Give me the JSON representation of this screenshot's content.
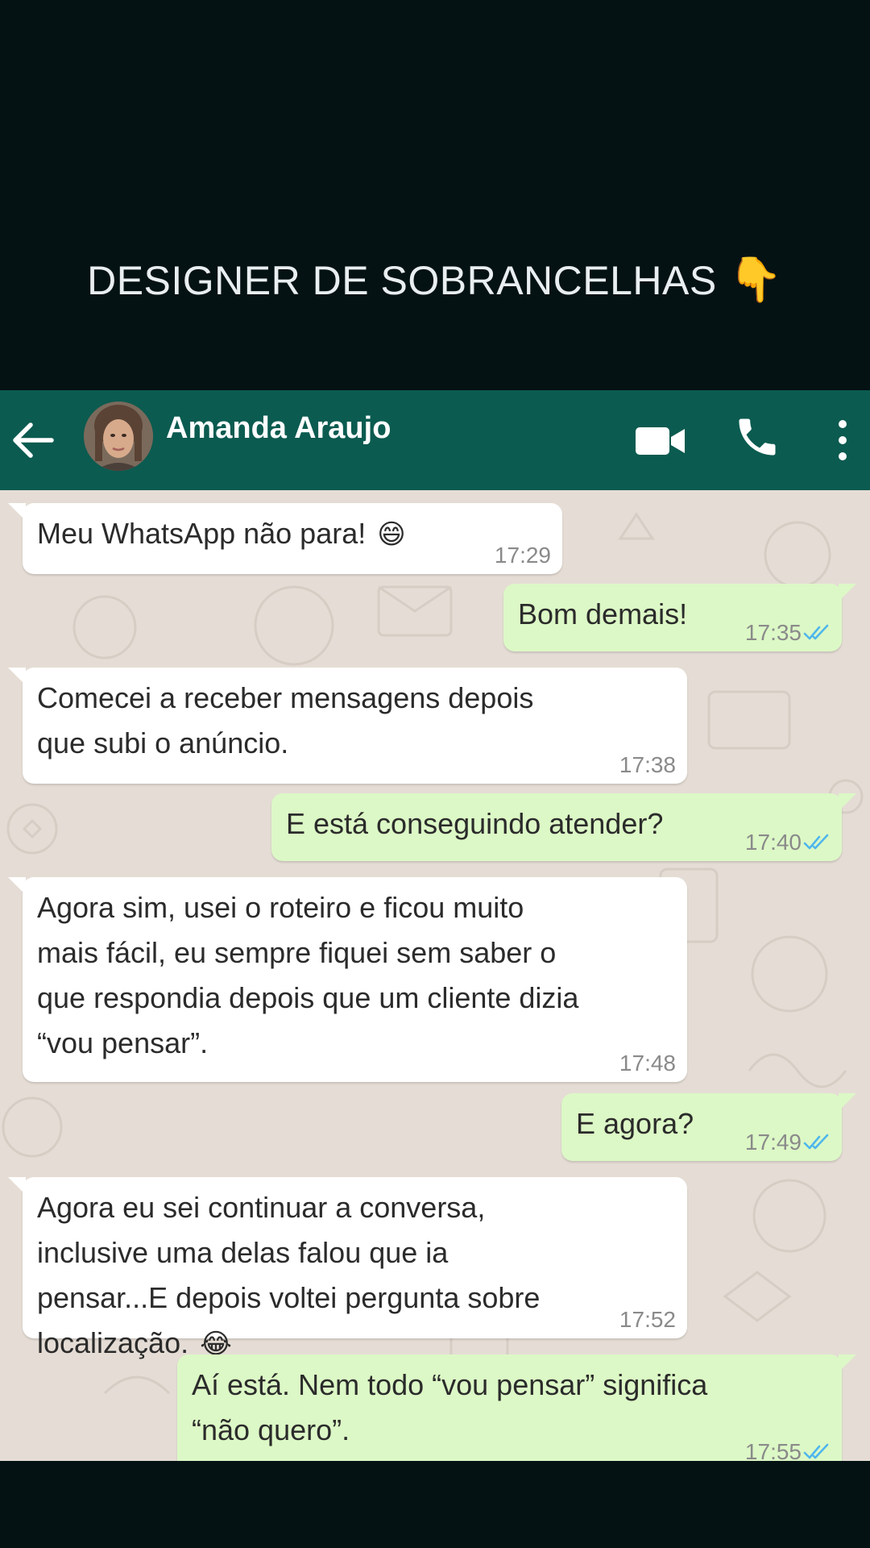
{
  "caption": {
    "text": "DESIGNER DE SOBRANCELHAS",
    "emoji": "👇",
    "emoji_name": "backhand-index-pointing-down"
  },
  "header": {
    "contact_name": "Amanda Araujo",
    "back_icon": "arrow-left-icon",
    "video_icon": "video-camera-icon",
    "call_icon": "phone-icon",
    "menu_icon": "more-vertical-icon"
  },
  "colors": {
    "header_bg": "#0b5b50",
    "chat_bg": "#e5ddd5",
    "incoming_bubble": "#ffffff",
    "outgoing_bubble": "#dcf8c6",
    "read_ticks": "#4fb6ec",
    "page_bg": "#051214"
  },
  "messages": [
    {
      "dir": "in",
      "text": "Meu WhatsApp não para!",
      "emoji": "😄",
      "time": "17:29"
    },
    {
      "dir": "out",
      "text": "Bom demais!",
      "time": "17:35",
      "status": "read"
    },
    {
      "dir": "in",
      "text": "Comecei a receber mensagens depois que subi o anúncio.",
      "time": "17:38"
    },
    {
      "dir": "out",
      "text": "E está conseguindo atender?",
      "time": "17:40",
      "status": "read"
    },
    {
      "dir": "in",
      "text": "Agora sim, usei o roteiro e ficou muito mais fácil, eu sempre fiquei sem saber o que respondia depois que um cliente dizia “vou pensar”.",
      "time": "17:48"
    },
    {
      "dir": "out",
      "text": "E agora?",
      "time": "17:49",
      "status": "read"
    },
    {
      "dir": "in",
      "text": "Agora eu sei continuar a conversa, inclusive uma delas falou que ia pensar...E depois voltei pergunta sobre localização.",
      "emoji": "😂",
      "time": "17:52"
    },
    {
      "dir": "out",
      "text": "Aí está. Nem todo “vou pensar” significa “não quero”.",
      "time": "17:55",
      "status": "read"
    }
  ]
}
